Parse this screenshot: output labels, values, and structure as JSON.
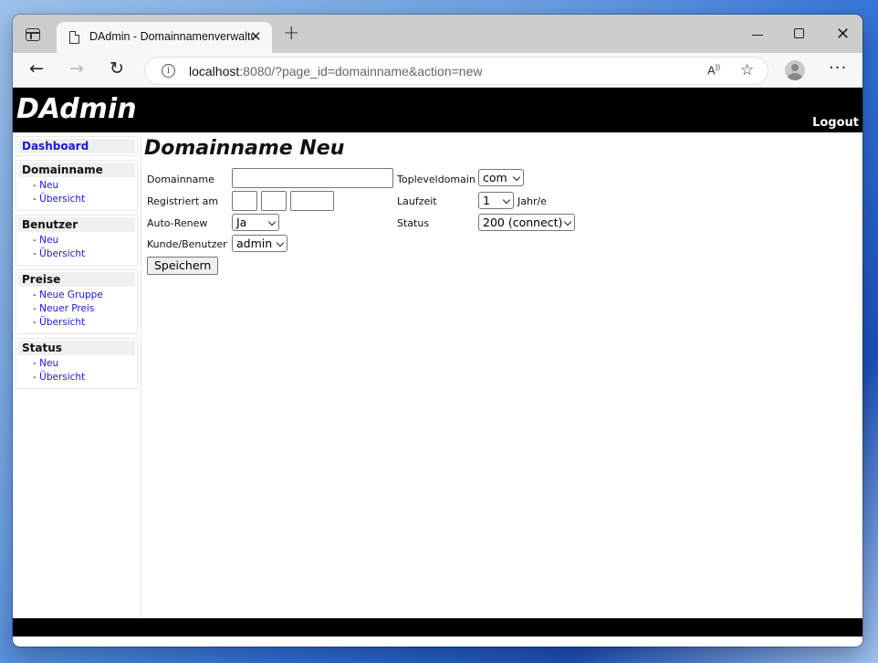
{
  "browser": {
    "tab_title": "DAdmin - Domainnamenverwaltung",
    "url_host": "localhost",
    "url_rest": ":8080/?page_id=domainname&action=new"
  },
  "app": {
    "title": "DAdmin",
    "logout_label": "Logout"
  },
  "sidebar": {
    "dashboard": "Dashboard",
    "sections": [
      {
        "title": "Domainname",
        "items": [
          "Neu",
          "Übersicht"
        ]
      },
      {
        "title": "Benutzer",
        "items": [
          "Neu",
          "Übersicht"
        ]
      },
      {
        "title": "Preise",
        "items": [
          "Neue Gruppe",
          "Neuer Preis",
          "Übersicht"
        ]
      },
      {
        "title": "Status",
        "items": [
          "Neu",
          "Übersicht"
        ]
      }
    ]
  },
  "page": {
    "title": "Domainname Neu",
    "labels": {
      "domainname": "Domainname",
      "registriert": "Registriert am",
      "autorenew": "Auto-Renew",
      "kunde": "Kunde/Benutzer",
      "tld": "Topleveldomain",
      "laufzeit": "Laufzeit",
      "laufzeit_unit": "Jahr/e",
      "status": "Status"
    },
    "values": {
      "tld": "com",
      "laufzeit": "1",
      "autorenew": "Ja",
      "status": "200 (connect)",
      "kunde": "admin"
    },
    "save_label": "Speichern"
  }
}
